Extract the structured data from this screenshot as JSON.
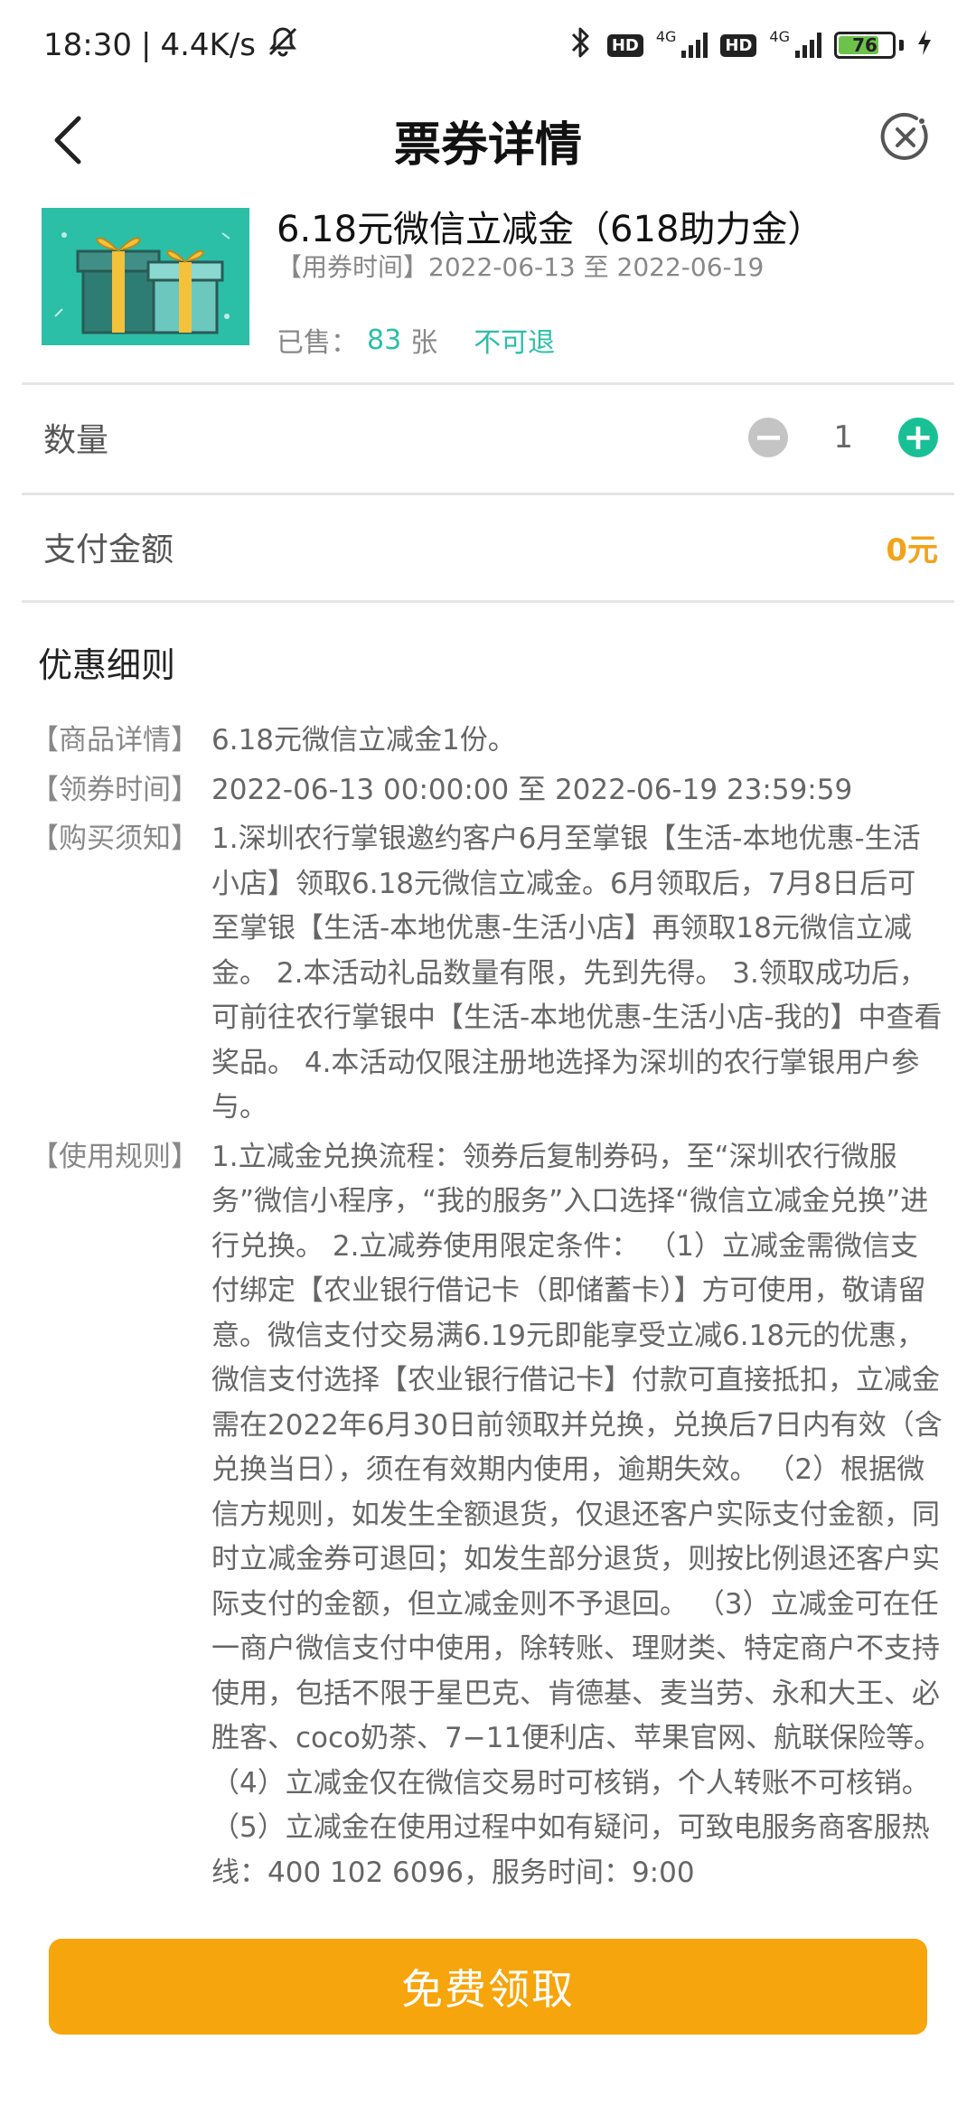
{
  "status_bar": {
    "time": "18:30",
    "speed": "4.4K/s",
    "network_1": "4G",
    "network_2": "4G",
    "hd": "HD",
    "battery": "76",
    "icons": [
      "mute-icon",
      "bluetooth-icon",
      "signal-icon",
      "battery-icon",
      "charging-icon"
    ]
  },
  "nav": {
    "title": "票券详情",
    "icons": [
      "back-arrow-icon",
      "close-icon"
    ]
  },
  "product": {
    "title": "6.18元微信立减金（618助力金）",
    "time_label": "【用券时间】",
    "time_range": "2022-06-13 至 2022-06-19",
    "sold_label": "已售：",
    "sold_count": "83",
    "sold_unit": "张",
    "refund_status": "不可退",
    "colors": {
      "accent": "#2bbfa8"
    }
  },
  "quantity": {
    "label": "数量",
    "value": "1",
    "minus": "−",
    "plus": "+"
  },
  "payment": {
    "label": "支付金额",
    "amount": "0元",
    "color": "#f2a31c"
  },
  "rules": {
    "heading": "优惠细则",
    "items": [
      {
        "label": "【商品详情】",
        "text": "6.18元微信立减金1份。"
      },
      {
        "label": "【领券时间】",
        "text": "2022-06-13 00:00:00 至 2022-06-19 23:59:59"
      },
      {
        "label": "【购买须知】",
        "text": "1.深圳农行掌银邀约客户6月至掌银【生活-本地优惠-生活小店】领取6.18元微信立减金。6月领取后，7月8日后可至掌银【生活-本地优惠-生活小店】再领取18元微信立减金。 2.本活动礼品数量有限，先到先得。 3.领取成功后，可前往农行掌银中【生活-本地优惠-生活小店-我的】中查看奖品。 4.本活动仅限注册地选择为深圳的农行掌银用户参与。"
      },
      {
        "label": "【使用规则】",
        "text": "1.立减金兑换流程：领券后复制券码，至“深圳农行微服务”微信小程序，“我的服务”入口选择“微信立减金兑换”进行兑换。 2.立减券使用限定条件： （1）立减金需微信支付绑定【农业银行借记卡（即储蓄卡）】方可使用，敬请留意。微信支付交易满6.19元即能享受立减6.18元的优惠，微信支付选择【农业银行借记卡】付款可直接抵扣，立减金需在2022年6月30日前领取并兑换，兑换后7日内有效（含兑换当日），须在有效期内使用，逾期失效。 （2）根据微信方规则，如发生全额退货，仅退还客户实际支付金额，同时立减金券可退回；如发生部分退货，则按比例退还客户实际支付的金额，但立减金则不予退回。 （3）立减金可在任一商户微信支付中使用，除转账、理财类、特定商户不支持使用，包括不限于星巴克、肯德基、麦当劳、永和大王、必胜客、coco奶茶、7−11便利店、苹果官网、航联保险等。 （4）立减金仅在微信交易时可核销，个人转账不可核销。 （5）立减金在使用过程中如有疑问，可致电服务商客服热线：400 102 6096，服务时间：9:00"
      }
    ]
  },
  "cta": {
    "label": "免费领取",
    "color": "#f7a50c"
  }
}
